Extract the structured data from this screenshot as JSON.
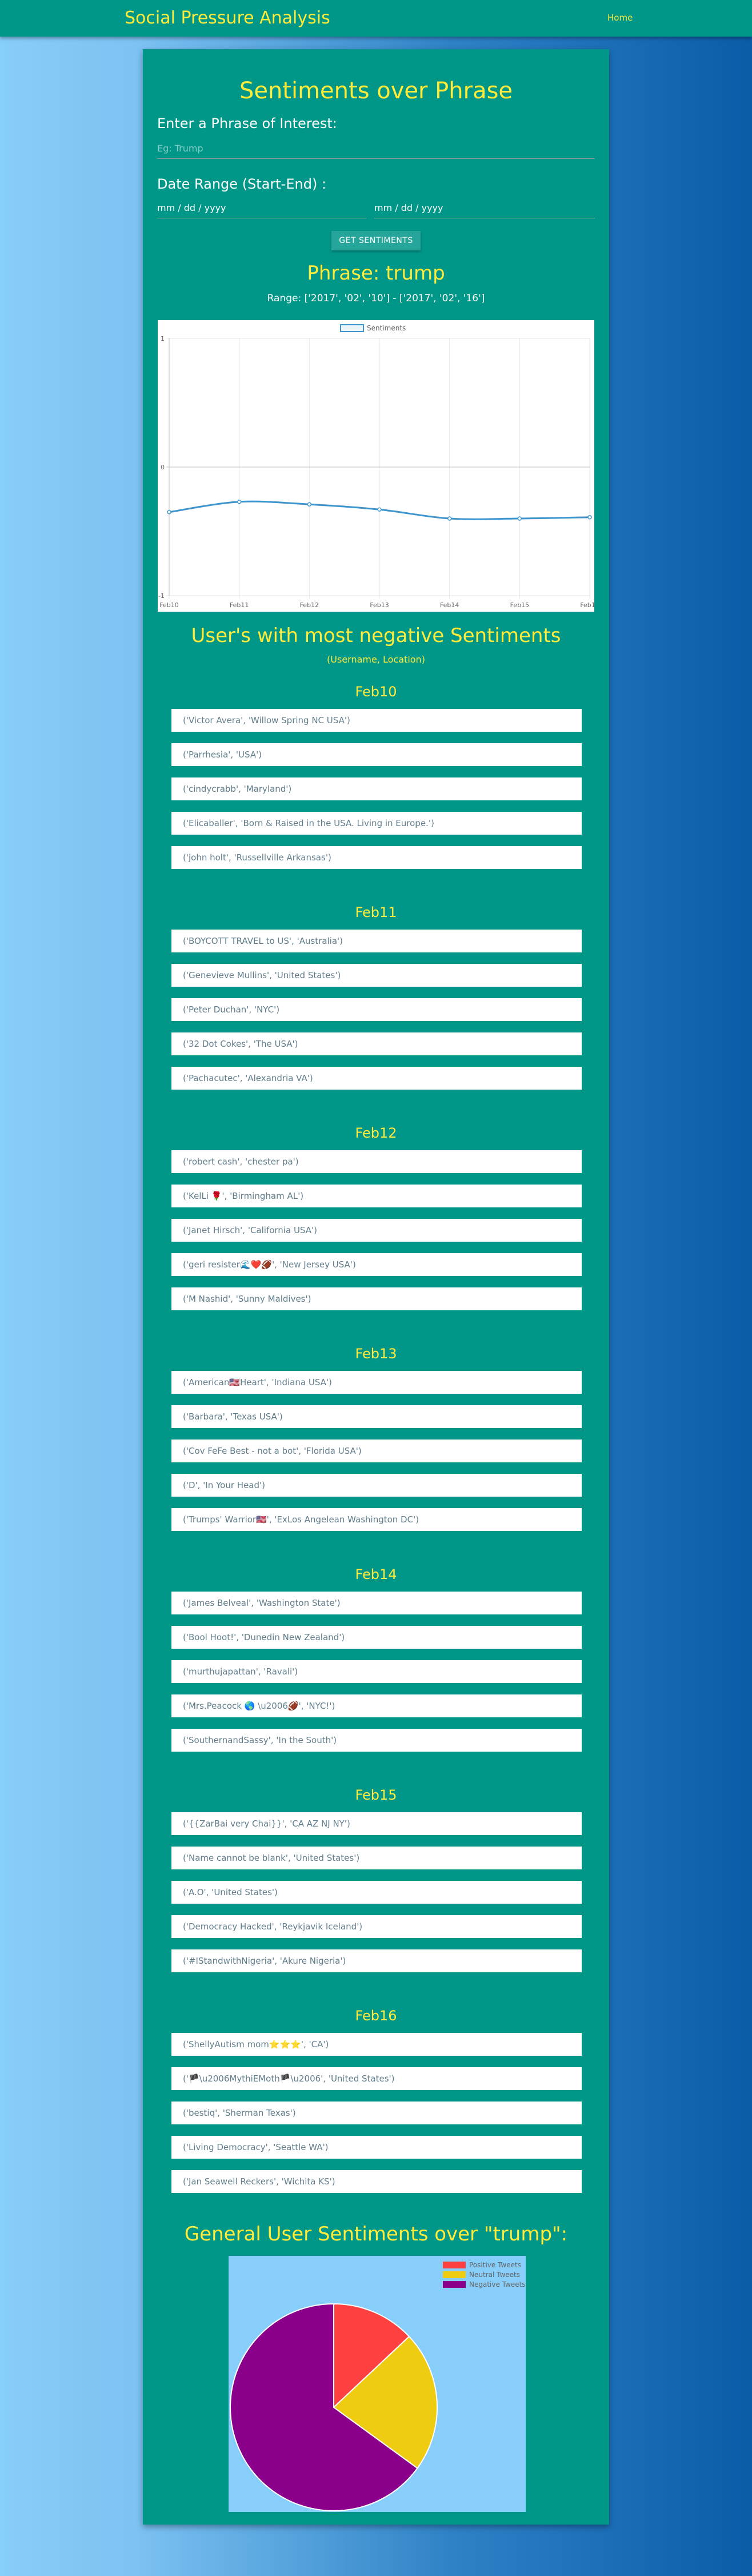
{
  "nav": {
    "brand": "Social Pressure Analysis",
    "home": "Home"
  },
  "page_title": "Sentiments over Phrase",
  "phrase_label": "Enter a Phrase of Interest:",
  "phrase_placeholder": "Eg: Trump",
  "date_label": "Date Range (Start-End) :",
  "date_start_placeholder": "mm / dd / yyyy",
  "date_end_placeholder": "mm / dd / yyyy",
  "button": "GET SENTIMENTS",
  "phrase_heading": "Phrase: trump",
  "range_text": "Range: ['2017', '02', '10'] - ['2017', '02', '16']",
  "colors": {
    "teal": "#009688",
    "yellow": "#ffeb3b",
    "line": "#3e95cd",
    "positive": "#ff4040",
    "neutral": "#eecc11",
    "negative": "#8b008b"
  },
  "chart_data": [
    {
      "type": "line",
      "categories": [
        "Feb10",
        "Feb11",
        "Feb12",
        "Feb13",
        "Feb14",
        "Feb15",
        "Feb16"
      ],
      "series": [
        {
          "name": "Sentiments",
          "values": [
            -0.35,
            -0.27,
            -0.29,
            -0.33,
            -0.4,
            -0.4,
            -0.39
          ]
        }
      ],
      "yticks": [
        "1",
        "0",
        "-1"
      ],
      "ylim": [
        -1,
        1
      ],
      "grid": true,
      "legend": "top"
    },
    {
      "type": "pie",
      "title": "General User Sentiments over \"trump\":",
      "labels": [
        "Positive Tweets",
        "Neutral Tweets",
        "Negative Tweets"
      ],
      "values": [
        13,
        22,
        65
      ],
      "legend": "top-right"
    }
  ],
  "neg_title": "User's with most negative Sentiments",
  "neg_subtitle": "(Username, Location)",
  "days": [
    {
      "date": "Feb10",
      "users": [
        "('Victor Avera', 'Willow Spring NC USA')",
        "('Parrhesia', 'USA')",
        "('cindycrabb', 'Maryland')",
        "('Elicaballer', 'Born & Raised in the USA. Living in Europe.')",
        "('john holt', 'Russellville Arkansas')"
      ]
    },
    {
      "date": "Feb11",
      "users": [
        "('BOYCOTT TRAVEL to US', 'Australia')",
        "('Genevieve Mullins', 'United States')",
        "('Peter Duchan', 'NYC')",
        "('32 Dot Cokes', 'The USA')",
        "('Pachacutec', 'Alexandria VA')"
      ]
    },
    {
      "date": "Feb12",
      "users": [
        "('robert cash', 'chester pa')",
        "('KelLi 🌹', 'Birmingham AL')",
        "('Janet Hirsch', 'California USA')",
        "('geri resister🌊❤️🏈', 'New Jersey USA')",
        "('M Nashid', 'Sunny Maldives')"
      ]
    },
    {
      "date": "Feb13",
      "users": [
        "('American🇺🇸Heart', 'Indiana USA')",
        "('Barbara', 'Texas USA')",
        "('Cov FeFe Best - not a bot', 'Florida USA')",
        "('D', 'In Your Head')",
        "('Trumps' Warrior🇺🇸', 'ExLos Angelean Washington DC')"
      ]
    },
    {
      "date": "Feb14",
      "users": [
        "('James Belveal', 'Washington State')",
        "('Bool Hoot!', 'Dunedin New Zealand')",
        "('murthujapattan', 'Ravali')",
        "('Mrs.Peacock 🌎 \\u2006🏈', 'NYC!')",
        "('SouthernandSassy', 'In the South')"
      ]
    },
    {
      "date": "Feb15",
      "users": [
        "('{{ZarBai very Chai}}', 'CA AZ NJ NY')",
        "('Name cannot be blank', 'United States')",
        "('A.O', 'United States')",
        "('Democracy Hacked', 'Reykjavik Iceland')",
        "('#IStandwithNigeria', 'Akure Nigeria')"
      ]
    },
    {
      "date": "Feb16",
      "users": [
        "('ShellyAutism mom⭐⭐⭐', 'CA')",
        "('🏴\\u2006MythiEMoth🏴\\u2006', 'United States')",
        "('bestiq', 'Sherman Texas')",
        "('Living Democracy', 'Seattle WA')",
        "('Jan Seawell Reckers', 'Wichita KS')"
      ]
    }
  ]
}
